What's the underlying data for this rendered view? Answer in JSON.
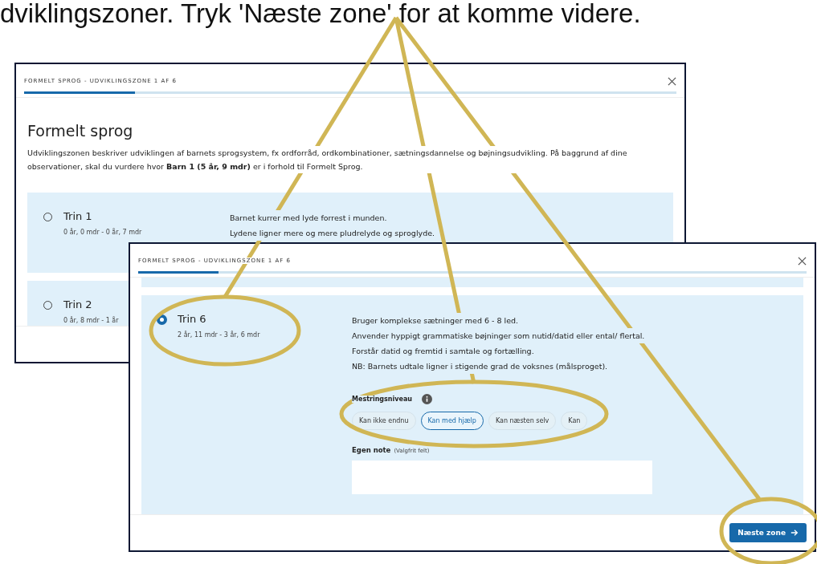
{
  "caption": "dviklingszoner. Tryk 'Næste zone' for at komme videre.",
  "windows": [
    {
      "title": "FORMELT SPROG - UDVIKLINGSZONE 1 AF 6",
      "progress": {
        "level": 0.17
      },
      "heading": "Formelt sprog",
      "description": "Udviklingszonen beskriver udviklingen af barnets sprogsystem, fx ordforråd, ordkombinationer, sætningsdannelse og bøjningsudvikling. På baggrund af dine observationer, skal du vurdere hvor **Barn 1 (5 år, 9 mdr)** er i forhold til Formelt Sprog.",
      "options": [
        {
          "label": "Trin 1",
          "range": "0 år, 0 mdr - 0 år, 7 mdr",
          "selected": false,
          "lines": [
            "Barnet kurrer med lyde forrest i munden.",
            "Lydene ligner mere og mere pludrelyde og sproglyde."
          ]
        },
        {
          "label": "Trin 2",
          "range": "0 år, 8 mdr - 1 år",
          "selected": false
        }
      ]
    },
    {
      "title": "FORMELT SPROG - UDVIKLINGSZONE 1 AF 6",
      "progress": {
        "level": 0.12
      },
      "options": [
        {
          "label": "Trin 6",
          "range": "2 år, 11 mdr - 3 år, 6 mdr",
          "selected": true,
          "lines": [
            "Bruger komplekse sætninger med 6 - 8 led.",
            "Anvender hyppigt grammatiske bøjninger som nutid/datid eller ental/ flertal.",
            "Forstår datid og fremtid i samtale og fortælling.",
            "NB: Barnets udtale ligner i stigende grad de voksnes (målsproget)."
          ],
          "mastery": {
            "label": "Mestringsniveau",
            "chips": [
              {
                "label": "Kan ikke endnu",
                "selected": false
              },
              {
                "label": "Kan med hjælp",
                "selected": true
              },
              {
                "label": "Kan næsten selv",
                "selected": false
              },
              {
                "label": "Kan",
                "selected": false
              }
            ]
          },
          "note": {
            "label": "Egen note",
            "hint": "(Valgfrit felt)"
          }
        }
      ],
      "next_button": "Næste zone"
    }
  ]
}
